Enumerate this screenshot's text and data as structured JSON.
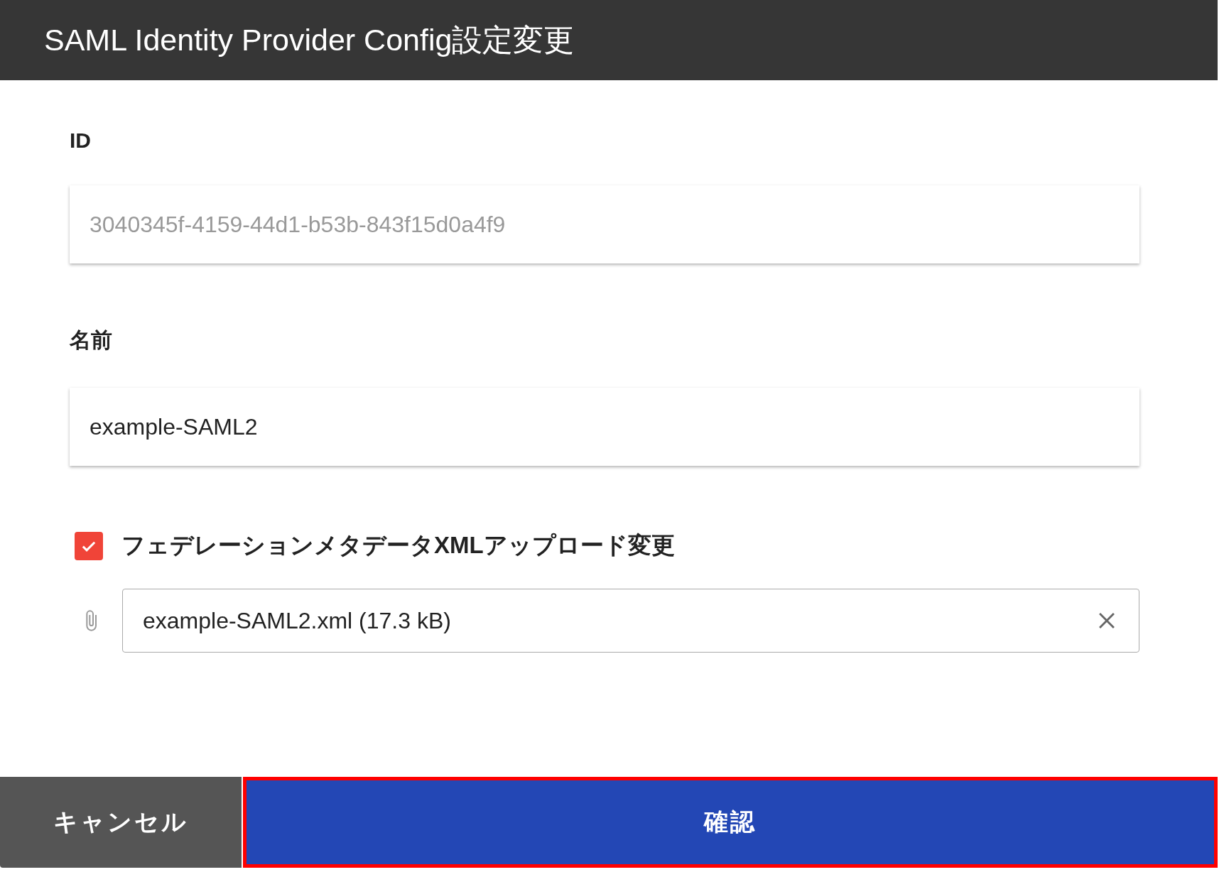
{
  "window": {
    "title": "SAML Identity Provider Config設定変更"
  },
  "fields": [
    {
      "label": "ID",
      "value": "3040345f-4159-44d1-b53b-843f15d0a4f9",
      "disabled": true
    },
    {
      "label": "名前",
      "value": "example-SAML2",
      "disabled": false
    }
  ],
  "metadata_upload": {
    "label": "フェデレーションメタデータXMLアップロード変更",
    "checked": true,
    "file": "example-SAML2.xml (17.3 kB)"
  },
  "buttons": [
    {
      "label": "キャンセル",
      "kind": "secondary",
      "highlighted": false
    },
    {
      "label": "確認",
      "kind": "primary",
      "highlighted": true
    }
  ]
}
